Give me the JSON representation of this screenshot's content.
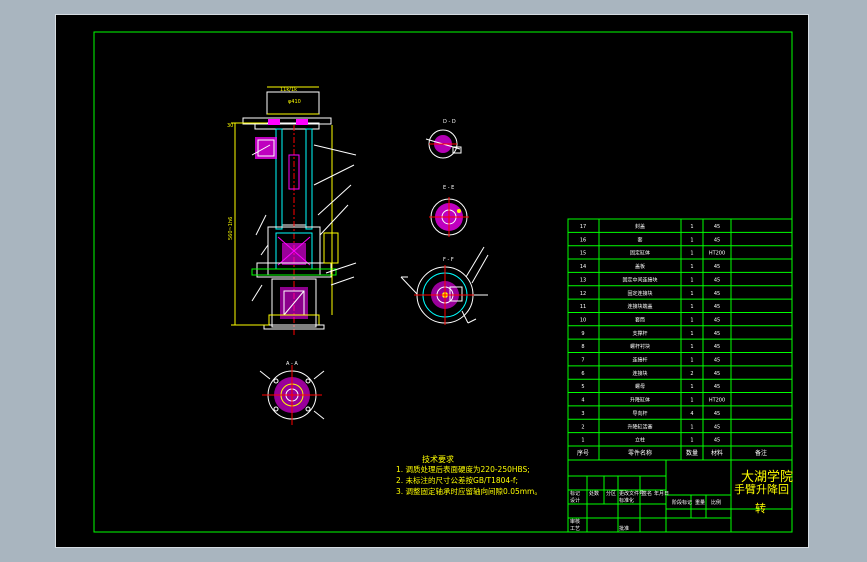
{
  "colors": {
    "background": "#000000",
    "frame": "#00ff00",
    "drawing": "#ffffff",
    "section": "#ff00ff",
    "dimension": "#00ffff",
    "notes": "#ffff00",
    "outline": "#00ff00",
    "viewport": "#a9b5bf"
  },
  "drawing": {
    "dims": {
      "top_width": "11k/1k",
      "top_dia": "φ410",
      "overall_height": "560~1h6",
      "left_mark": "30"
    },
    "section_labels": {
      "view1": "D - D",
      "view2": "E - E",
      "view3": "F - F",
      "view4": "A - A"
    }
  },
  "tech_requirements": {
    "title": "技术要求",
    "lines": [
      "1. 调质处理后表面硬度为220-250HBS;",
      "2. 未标注的尺寸公差按GB/T1804-f;",
      "3. 调整固定轴承时应留轴向间隙0.05mm。"
    ]
  },
  "parts_table": {
    "header": {
      "no": "序号",
      "name": "零件名称",
      "qty": "数量",
      "material": "材料",
      "remark": "备注"
    },
    "rows": [
      {
        "no": "17",
        "name": "封盖",
        "qty": "1",
        "material": "45"
      },
      {
        "no": "16",
        "name": "套",
        "qty": "1",
        "material": "45"
      },
      {
        "no": "15",
        "name": "固定缸体",
        "qty": "1",
        "material": "HT200"
      },
      {
        "no": "14",
        "name": "盖板",
        "qty": "1",
        "material": "45"
      },
      {
        "no": "13",
        "name": "固定中间连接块",
        "qty": "1",
        "material": "45"
      },
      {
        "no": "12",
        "name": "固定连接块",
        "qty": "1",
        "material": "45"
      },
      {
        "no": "11",
        "name": "连接块端盖",
        "qty": "1",
        "material": "45"
      },
      {
        "no": "10",
        "name": "套筒",
        "qty": "1",
        "material": "45"
      },
      {
        "no": "9",
        "name": "支撑杆",
        "qty": "1",
        "material": "45"
      },
      {
        "no": "8",
        "name": "螺杆衬块",
        "qty": "1",
        "material": "45"
      },
      {
        "no": "7",
        "name": "连接杆",
        "qty": "1",
        "material": "45"
      },
      {
        "no": "6",
        "name": "连接块",
        "qty": "2",
        "material": "45"
      },
      {
        "no": "5",
        "name": "螺母",
        "qty": "1",
        "material": "45"
      },
      {
        "no": "4",
        "name": "升降缸体",
        "qty": "1",
        "material": "HT200"
      },
      {
        "no": "3",
        "name": "导向杆",
        "qty": "4",
        "material": "45"
      },
      {
        "no": "2",
        "name": "升降缸活塞",
        "qty": "1",
        "material": "45"
      },
      {
        "no": "1",
        "name": "立柱",
        "qty": "1",
        "material": "45"
      }
    ]
  },
  "title_block": {
    "school": "大湖学院",
    "title_line1": "手臂升降回",
    "title_line2": "转",
    "label_mark": "标记",
    "label_count": "处数",
    "label_area": "分区",
    "label_doc": "更改文件号",
    "label_sign": "签名",
    "label_date": "年月日",
    "label_design": "设计",
    "label_std": "标准化",
    "label_check": "审核",
    "label_craft": "工艺",
    "label_approve": "批准",
    "label_stage": "阶段标记",
    "label_weight": "重量",
    "label_scale": "比例"
  }
}
